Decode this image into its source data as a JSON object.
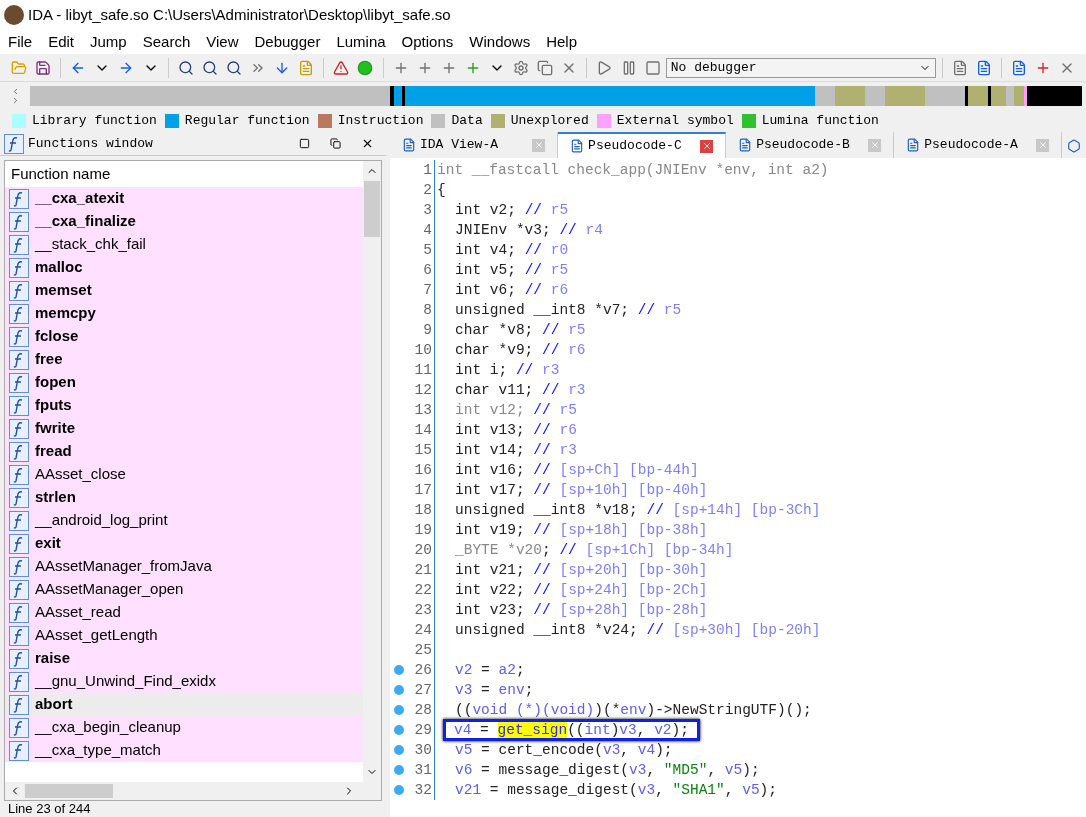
{
  "window": {
    "title": "IDA - libyt_safe.so C:\\Users\\Administrator\\Desktop\\libyt_safe.so"
  },
  "menu": [
    "File",
    "Edit",
    "Jump",
    "Search",
    "View",
    "Debugger",
    "Lumina",
    "Options",
    "Windows",
    "Help"
  ],
  "toolbar": {
    "debugger_select": "No debugger"
  },
  "legend": [
    {
      "label": "Library function",
      "color": "#aaffff"
    },
    {
      "label": "Regular function",
      "color": "#00a0e6"
    },
    {
      "label": "Instruction",
      "color": "#b87a5a"
    },
    {
      "label": "Data",
      "color": "#c0c0c0"
    },
    {
      "label": "Unexplored",
      "color": "#b0b070"
    },
    {
      "label": "External symbol",
      "color": "#ffa0ff"
    },
    {
      "label": "Lumina function",
      "color": "#30c030"
    }
  ],
  "functions_window": {
    "title": "Functions window",
    "column": "Function name",
    "status": "Line 23 of 244",
    "items": [
      {
        "name": "__cxa_atexit",
        "bold": true,
        "selected": false
      },
      {
        "name": "__cxa_finalize",
        "bold": true,
        "selected": false
      },
      {
        "name": "__stack_chk_fail",
        "bold": false,
        "selected": false
      },
      {
        "name": "malloc",
        "bold": true,
        "selected": false
      },
      {
        "name": "memset",
        "bold": true,
        "selected": false
      },
      {
        "name": "memcpy",
        "bold": true,
        "selected": false
      },
      {
        "name": "fclose",
        "bold": true,
        "selected": false
      },
      {
        "name": "free",
        "bold": true,
        "selected": false
      },
      {
        "name": "fopen",
        "bold": true,
        "selected": false
      },
      {
        "name": "fputs",
        "bold": true,
        "selected": false
      },
      {
        "name": "fwrite",
        "bold": true,
        "selected": false
      },
      {
        "name": "fread",
        "bold": true,
        "selected": false
      },
      {
        "name": "AAsset_close",
        "bold": false,
        "selected": false
      },
      {
        "name": "strlen",
        "bold": true,
        "selected": false
      },
      {
        "name": "__android_log_print",
        "bold": false,
        "selected": false
      },
      {
        "name": "exit",
        "bold": true,
        "selected": false
      },
      {
        "name": "AAssetManager_fromJava",
        "bold": false,
        "selected": false
      },
      {
        "name": "AAssetManager_open",
        "bold": false,
        "selected": false
      },
      {
        "name": "AAsset_read",
        "bold": false,
        "selected": false
      },
      {
        "name": "AAsset_getLength",
        "bold": false,
        "selected": false
      },
      {
        "name": "raise",
        "bold": true,
        "selected": false
      },
      {
        "name": "__gnu_Unwind_Find_exidx",
        "bold": false,
        "selected": false
      },
      {
        "name": "abort",
        "bold": true,
        "selected": true
      },
      {
        "name": "__cxa_begin_cleanup",
        "bold": false,
        "selected": false
      },
      {
        "name": "__cxa_type_match",
        "bold": false,
        "selected": false
      }
    ]
  },
  "tabs": [
    {
      "label": "IDA View-A",
      "selected": false
    },
    {
      "label": "Pseudocode-C",
      "selected": true
    },
    {
      "label": "Pseudocode-B",
      "selected": false
    },
    {
      "label": "Pseudocode-A",
      "selected": false
    }
  ],
  "code": [
    {
      "n": "1",
      "indent": false,
      "breakpoint": false,
      "boxed": false,
      "segments": [
        {
          "kind": "dim",
          "text": "int __fastcall check_app(JNIEnv *env, int a2)"
        }
      ]
    },
    {
      "n": "2",
      "indent": false,
      "breakpoint": false,
      "boxed": false,
      "segments": [
        {
          "kind": "t",
          "text": "{"
        }
      ]
    },
    {
      "n": "3",
      "indent": true,
      "breakpoint": false,
      "boxed": false,
      "segments": [
        {
          "kind": "t",
          "text": "int v2; "
        },
        {
          "kind": "cm",
          "text": "// "
        },
        {
          "kind": "rg",
          "text": "r5"
        }
      ]
    },
    {
      "n": "4",
      "indent": true,
      "breakpoint": false,
      "boxed": false,
      "segments": [
        {
          "kind": "t",
          "text": "JNIEnv *v3; "
        },
        {
          "kind": "cm",
          "text": "// "
        },
        {
          "kind": "rg",
          "text": "r4"
        }
      ]
    },
    {
      "n": "5",
      "indent": true,
      "breakpoint": false,
      "boxed": false,
      "segments": [
        {
          "kind": "t",
          "text": "int v4; "
        },
        {
          "kind": "cm",
          "text": "// "
        },
        {
          "kind": "rg",
          "text": "r0"
        }
      ]
    },
    {
      "n": "6",
      "indent": true,
      "breakpoint": false,
      "boxed": false,
      "segments": [
        {
          "kind": "t",
          "text": "int v5; "
        },
        {
          "kind": "cm",
          "text": "// "
        },
        {
          "kind": "rg",
          "text": "r5"
        }
      ]
    },
    {
      "n": "7",
      "indent": true,
      "breakpoint": false,
      "boxed": false,
      "segments": [
        {
          "kind": "t",
          "text": "int v6; "
        },
        {
          "kind": "cm",
          "text": "// "
        },
        {
          "kind": "rg",
          "text": "r6"
        }
      ]
    },
    {
      "n": "8",
      "indent": true,
      "breakpoint": false,
      "boxed": false,
      "segments": [
        {
          "kind": "t",
          "text": "unsigned __int8 *v7; "
        },
        {
          "kind": "cm",
          "text": "// "
        },
        {
          "kind": "rg",
          "text": "r5"
        }
      ]
    },
    {
      "n": "9",
      "indent": true,
      "breakpoint": false,
      "boxed": false,
      "segments": [
        {
          "kind": "t",
          "text": "char *v8; "
        },
        {
          "kind": "cm",
          "text": "// "
        },
        {
          "kind": "rg",
          "text": "r5"
        }
      ]
    },
    {
      "n": "10",
      "indent": true,
      "breakpoint": false,
      "boxed": false,
      "segments": [
        {
          "kind": "t",
          "text": "char *v9; "
        },
        {
          "kind": "cm",
          "text": "// "
        },
        {
          "kind": "rg",
          "text": "r6"
        }
      ]
    },
    {
      "n": "11",
      "indent": true,
      "breakpoint": false,
      "boxed": false,
      "segments": [
        {
          "kind": "t",
          "text": "int i; "
        },
        {
          "kind": "cm",
          "text": "// "
        },
        {
          "kind": "rg",
          "text": "r3"
        }
      ]
    },
    {
      "n": "12",
      "indent": true,
      "breakpoint": false,
      "boxed": false,
      "segments": [
        {
          "kind": "t",
          "text": "char v11; "
        },
        {
          "kind": "cm",
          "text": "// "
        },
        {
          "kind": "rg",
          "text": "r3"
        }
      ]
    },
    {
      "n": "13",
      "indent": true,
      "breakpoint": false,
      "boxed": false,
      "segments": [
        {
          "kind": "dim",
          "text": "int v12; "
        },
        {
          "kind": "cm",
          "text": "// "
        },
        {
          "kind": "rg",
          "text": "r5"
        }
      ]
    },
    {
      "n": "14",
      "indent": true,
      "breakpoint": false,
      "boxed": false,
      "segments": [
        {
          "kind": "t",
          "text": "int v13; "
        },
        {
          "kind": "cm",
          "text": "// "
        },
        {
          "kind": "rg",
          "text": "r6"
        }
      ]
    },
    {
      "n": "15",
      "indent": true,
      "breakpoint": false,
      "boxed": false,
      "segments": [
        {
          "kind": "t",
          "text": "int v14; "
        },
        {
          "kind": "cm",
          "text": "// "
        },
        {
          "kind": "rg",
          "text": "r3"
        }
      ]
    },
    {
      "n": "16",
      "indent": true,
      "breakpoint": false,
      "boxed": false,
      "segments": [
        {
          "kind": "t",
          "text": "int v16; "
        },
        {
          "kind": "cm",
          "text": "// "
        },
        {
          "kind": "rg",
          "text": "[sp+Ch] [bp-44h]"
        }
      ]
    },
    {
      "n": "17",
      "indent": true,
      "breakpoint": false,
      "boxed": false,
      "segments": [
        {
          "kind": "t",
          "text": "int v17; "
        },
        {
          "kind": "cm",
          "text": "// "
        },
        {
          "kind": "rg",
          "text": "[sp+10h] [bp-40h]"
        }
      ]
    },
    {
      "n": "18",
      "indent": true,
      "breakpoint": false,
      "boxed": false,
      "segments": [
        {
          "kind": "t",
          "text": "unsigned __int8 *v18; "
        },
        {
          "kind": "cm",
          "text": "// "
        },
        {
          "kind": "rg",
          "text": "[sp+14h] [bp-3Ch]"
        }
      ]
    },
    {
      "n": "19",
      "indent": true,
      "breakpoint": false,
      "boxed": false,
      "segments": [
        {
          "kind": "t",
          "text": "int v19; "
        },
        {
          "kind": "cm",
          "text": "// "
        },
        {
          "kind": "rg",
          "text": "[sp+18h] [bp-38h]"
        }
      ]
    },
    {
      "n": "20",
      "indent": true,
      "breakpoint": false,
      "boxed": false,
      "segments": [
        {
          "kind": "dim",
          "text": "_BYTE *v20"
        },
        {
          "kind": "t",
          "text": "; "
        },
        {
          "kind": "cm",
          "text": "// "
        },
        {
          "kind": "rg",
          "text": "[sp+1Ch] [bp-34h]"
        }
      ]
    },
    {
      "n": "21",
      "indent": true,
      "breakpoint": false,
      "boxed": false,
      "segments": [
        {
          "kind": "t",
          "text": "int v21; "
        },
        {
          "kind": "cm",
          "text": "// "
        },
        {
          "kind": "rg",
          "text": "[sp+20h] [bp-30h]"
        }
      ]
    },
    {
      "n": "22",
      "indent": true,
      "breakpoint": false,
      "boxed": false,
      "segments": [
        {
          "kind": "t",
          "text": "int v22; "
        },
        {
          "kind": "cm",
          "text": "// "
        },
        {
          "kind": "rg",
          "text": "[sp+24h] [bp-2Ch]"
        }
      ]
    },
    {
      "n": "23",
      "indent": true,
      "breakpoint": false,
      "boxed": false,
      "segments": [
        {
          "kind": "t",
          "text": "int v23; "
        },
        {
          "kind": "cm",
          "text": "// "
        },
        {
          "kind": "rg",
          "text": "[sp+28h] [bp-28h]"
        }
      ]
    },
    {
      "n": "24",
      "indent": true,
      "breakpoint": false,
      "boxed": false,
      "segments": [
        {
          "kind": "t",
          "text": "unsigned __int8 *v24; "
        },
        {
          "kind": "cm",
          "text": "// "
        },
        {
          "kind": "rg",
          "text": "[sp+30h] [bp-20h]"
        }
      ]
    },
    {
      "n": "25",
      "breakpoint": false
    },
    {
      "n": "26",
      "indent": true,
      "breakpoint": true,
      "boxed": false,
      "segments": [
        {
          "kind": "var",
          "text": "v2"
        },
        {
          "kind": "t",
          "text": " = "
        },
        {
          "kind": "var",
          "text": "a2"
        },
        {
          "kind": "t",
          "text": ";"
        }
      ]
    },
    {
      "n": "27",
      "indent": true,
      "breakpoint": true,
      "boxed": false,
      "segments": [
        {
          "kind": "var",
          "text": "v3"
        },
        {
          "kind": "t",
          "text": " = "
        },
        {
          "kind": "var",
          "text": "env"
        },
        {
          "kind": "t",
          "text": ";"
        }
      ]
    },
    {
      "n": "28",
      "indent": true,
      "breakpoint": true,
      "boxed": false,
      "segments": [
        {
          "kind": "t",
          "text": "(("
        },
        {
          "kind": "var",
          "text": "void (*)(void)"
        },
        {
          "kind": "t",
          "text": ")(*"
        },
        {
          "kind": "var",
          "text": "env"
        },
        {
          "kind": "t",
          "text": ")->NewStringUTF)();"
        }
      ]
    },
    {
      "n": "29",
      "indent": true,
      "breakpoint": true,
      "boxed": true,
      "segments": [
        {
          "kind": "var",
          "text": "v4"
        },
        {
          "kind": "t",
          "text": " = "
        },
        {
          "kind": "hl",
          "text": "get_sign"
        },
        {
          "kind": "t",
          "text": "(("
        },
        {
          "kind": "var",
          "text": "int"
        },
        {
          "kind": "t",
          "text": ")"
        },
        {
          "kind": "var",
          "text": "v3"
        },
        {
          "kind": "t",
          "text": ", "
        },
        {
          "kind": "var",
          "text": "v2"
        },
        {
          "kind": "t",
          "text": ");"
        }
      ]
    },
    {
      "n": "30",
      "indent": true,
      "breakpoint": true,
      "boxed": false,
      "segments": [
        {
          "kind": "var",
          "text": "v5"
        },
        {
          "kind": "t",
          "text": " = cert_encode("
        },
        {
          "kind": "var",
          "text": "v3"
        },
        {
          "kind": "t",
          "text": ", "
        },
        {
          "kind": "var",
          "text": "v4"
        },
        {
          "kind": "t",
          "text": ");"
        }
      ]
    },
    {
      "n": "31",
      "indent": true,
      "breakpoint": true,
      "boxed": false,
      "segments": [
        {
          "kind": "var",
          "text": "v6"
        },
        {
          "kind": "t",
          "text": " = message_digest("
        },
        {
          "kind": "var",
          "text": "v3"
        },
        {
          "kind": "t",
          "text": ", "
        },
        {
          "kind": "str",
          "text": "\"MD5\""
        },
        {
          "kind": "t",
          "text": ", "
        },
        {
          "kind": "var",
          "text": "v5"
        },
        {
          "kind": "t",
          "text": ");"
        }
      ]
    },
    {
      "n": "32",
      "indent": true,
      "breakpoint": true,
      "boxed": false,
      "segments": [
        {
          "kind": "var",
          "text": "v21"
        },
        {
          "kind": "t",
          "text": " = message_digest("
        },
        {
          "kind": "var",
          "text": "v3"
        },
        {
          "kind": "t",
          "text": ", "
        },
        {
          "kind": "str",
          "text": "\"SHA1\""
        },
        {
          "kind": "t",
          "text": ", "
        },
        {
          "kind": "var",
          "text": "v5"
        },
        {
          "kind": "t",
          "text": ");"
        }
      ]
    }
  ]
}
